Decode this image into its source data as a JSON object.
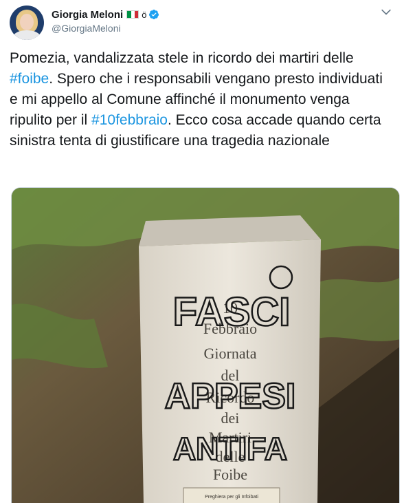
{
  "user": {
    "display_name": "Giorgia Meloni",
    "extra_char": "ö",
    "handle": "@GiorgiaMeloni",
    "flag": "italy-flag-icon",
    "verified": "verified-badge-icon"
  },
  "tweet": {
    "text_parts": [
      {
        "text": "Pomezia, vandalizzata stele in ricordo dei martiri delle ",
        "link": false
      },
      {
        "text": "#foibe",
        "link": true
      },
      {
        "text": ". Spero che i responsabili vengano presto individuati e mi appello al Comune affinché il monumento venga ripulito per il ",
        "link": false
      },
      {
        "text": "#10febbraio",
        "link": true
      },
      {
        "text": ". Ecco cosa accade quando certa sinistra tenta di giustificare una tragedia nazionale",
        "link": false
      }
    ]
  },
  "photo": {
    "engraving": [
      "10",
      "Febbraio",
      "Giornata",
      "del",
      "Ricordo",
      "dei",
      "Martiri",
      "delle",
      "Foibe"
    ],
    "graffiti": [
      "FASCI",
      "APPESI",
      "ANTIFA"
    ],
    "plaque": [
      "Preghiera per gli Infoibati"
    ]
  },
  "colors": {
    "link": "#1b95e0",
    "verified": "#1da1f2",
    "handle": "#657786"
  }
}
